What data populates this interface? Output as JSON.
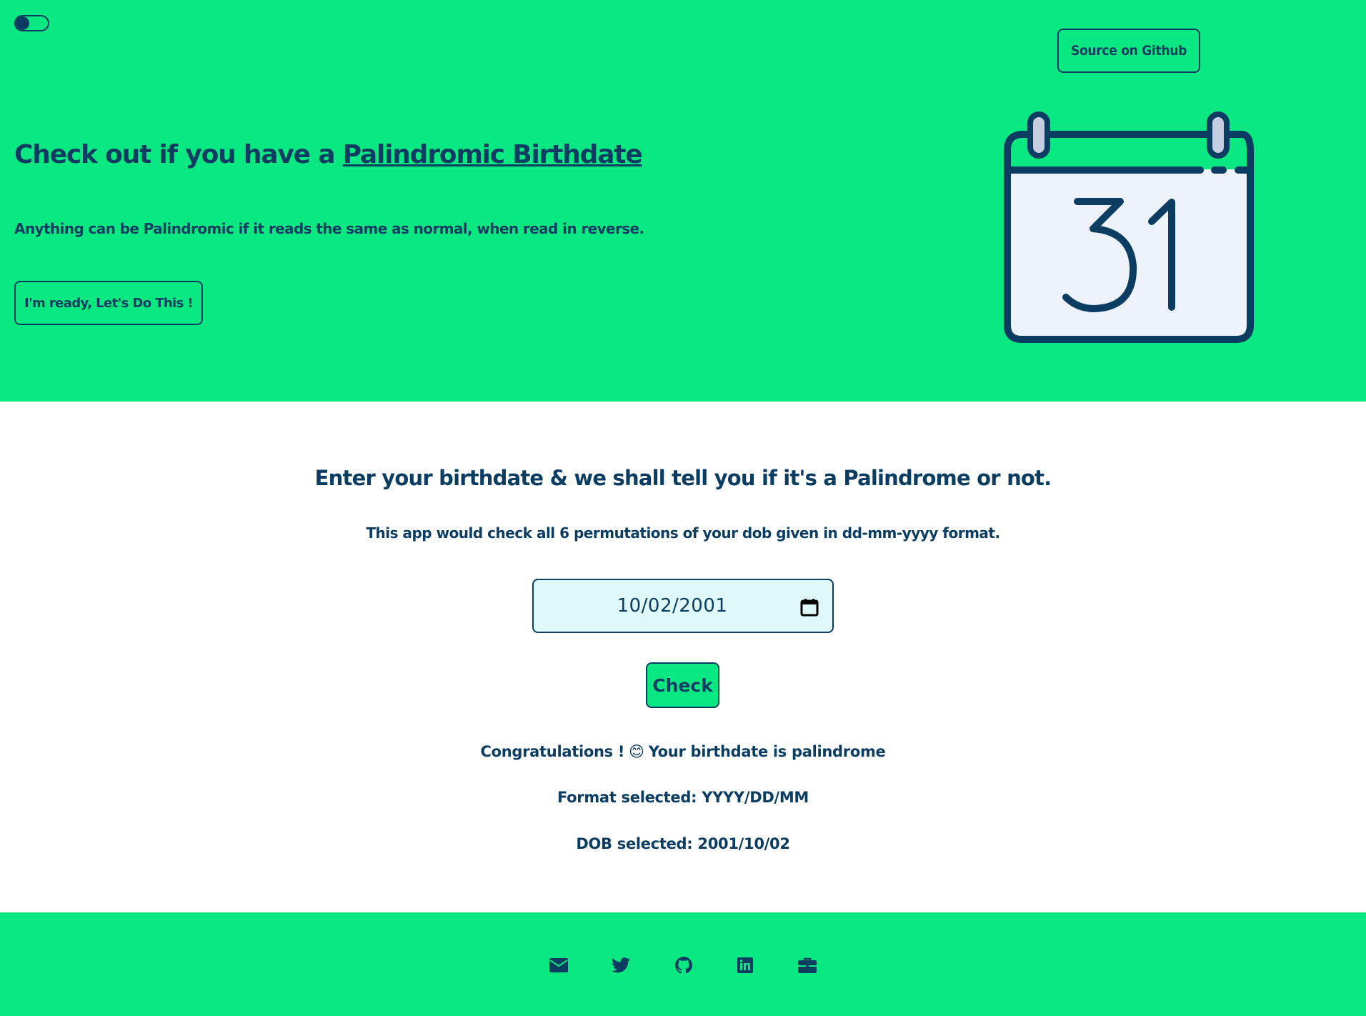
{
  "colors": {
    "brand_green": "#0ae981",
    "navy": "#0b3d62",
    "input_bg": "#dff8f9"
  },
  "header": {
    "theme_toggle": "dark-mode-toggle",
    "github_button": "Source on Github",
    "title_prefix": "Check out if you have a ",
    "title_link": "Palindromic Birthdate",
    "subtitle": "Anything can be Palindromic if it reads the same as normal, when read in reverse.",
    "cta_button": "I'm ready, Let's Do This !",
    "illustration": {
      "icon": "calendar-icon",
      "day": "31"
    }
  },
  "main": {
    "title": "Enter your birthdate & we shall tell you if it's a Palindrome or not.",
    "description": "This app would check all 6 permutations of your dob given in dd-mm-yyyy format.",
    "date_input_value": "10/02/2001",
    "check_button": "Check",
    "result": {
      "congrats": "Congratulations !",
      "emoji": "😊",
      "message": "Your birthdate is palindrome",
      "format": "Format selected: YYYY/DD/MM",
      "dob": "DOB selected: 2001/10/02"
    }
  },
  "footer": {
    "icons": [
      "envelope-icon",
      "twitter-icon",
      "github-icon",
      "linkedin-icon",
      "briefcase-icon"
    ]
  }
}
